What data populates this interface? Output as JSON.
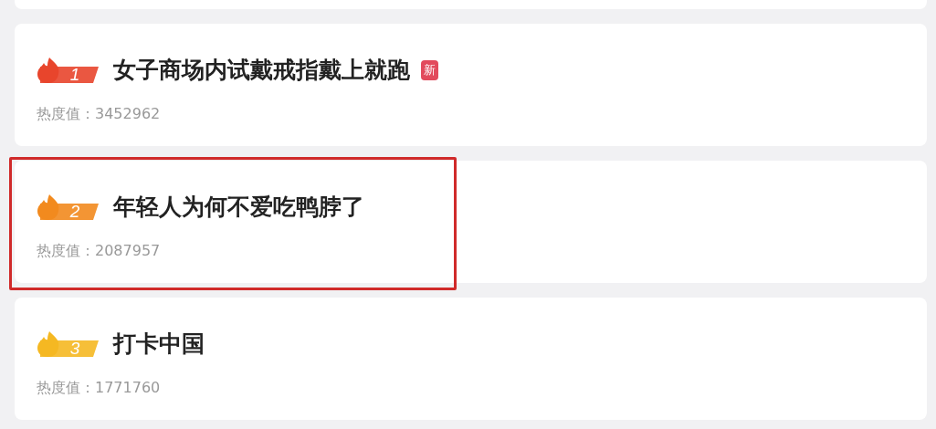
{
  "items": [
    {
      "rank": "1",
      "color": "#e8452c",
      "title": "女子商场内试戴戒指戴上就跑",
      "new_badge": "新",
      "heat_label": "热度值：",
      "heat": "3452962",
      "highlighted": false
    },
    {
      "rank": "2",
      "color": "#f28a1e",
      "title": "年轻人为何不爱吃鸭脖了",
      "heat_label": "热度值：",
      "heat": "2087957",
      "highlighted": true
    },
    {
      "rank": "3",
      "color": "#f5b822",
      "title": "打卡中国",
      "heat_label": "热度值：",
      "heat": "1771760",
      "highlighted": false
    }
  ]
}
